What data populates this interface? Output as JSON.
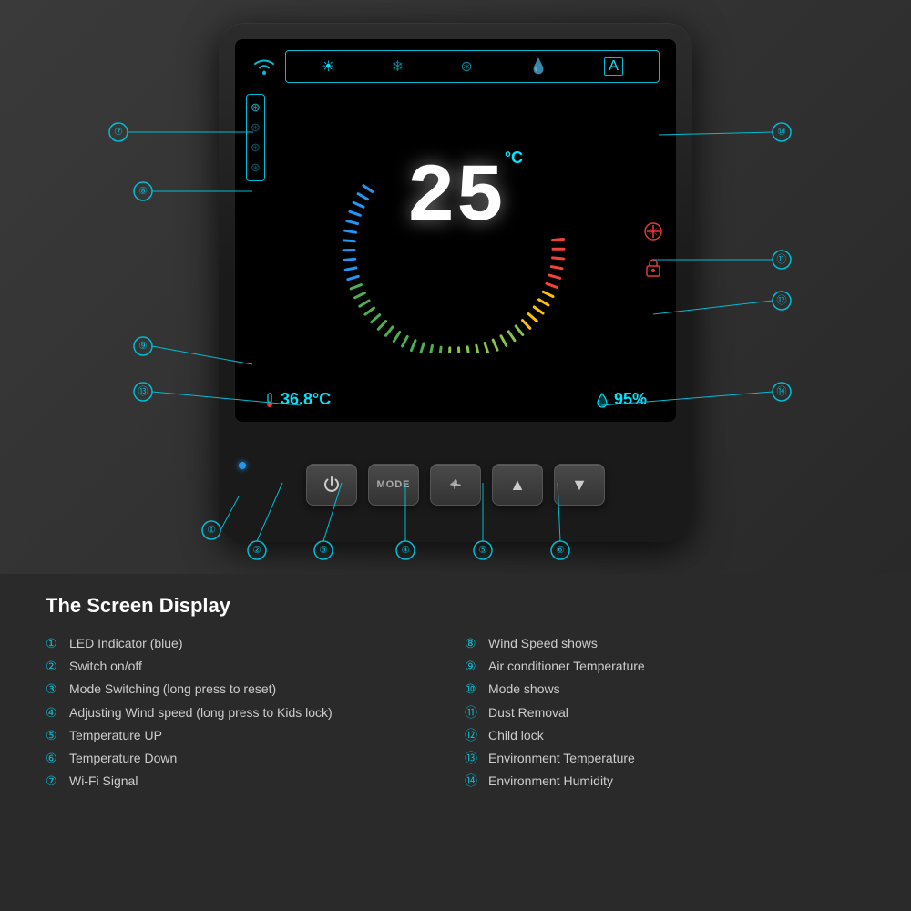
{
  "page": {
    "background_color": "#2a2a2a"
  },
  "device": {
    "screen": {
      "temperature_value": "25",
      "temperature_unit": "°C",
      "env_temp": "36.8°C",
      "env_humidity": "95%",
      "mode_icons": [
        "☀",
        "❄",
        "✦",
        "◈",
        "A"
      ],
      "fan_speeds": 4,
      "gauge_min": 16,
      "gauge_max": 30
    },
    "buttons": [
      {
        "label": "⏻",
        "id": "power"
      },
      {
        "label": "MODE",
        "id": "mode"
      },
      {
        "label": "✦",
        "id": "fan"
      },
      {
        "label": "▲",
        "id": "temp-up"
      },
      {
        "label": "▼",
        "id": "temp-down"
      }
    ]
  },
  "annotations": {
    "items": [
      {
        "num": "①",
        "label": "LED Indicator (blue)"
      },
      {
        "num": "②",
        "label": "Switch on/off"
      },
      {
        "num": "③",
        "label": "Mode Switching (long press to reset)"
      },
      {
        "num": "④",
        "label": "Adjusting Wind speed (long press to Kids lock)"
      },
      {
        "num": "⑤",
        "label": "Temperature UP"
      },
      {
        "num": "⑥",
        "label": "Temperature Down"
      },
      {
        "num": "⑦",
        "label": "Wi-Fi Signal"
      },
      {
        "num": "⑧",
        "label": "Wind Speed shows"
      },
      {
        "num": "⑨",
        "label": "Air conditioner Temperature"
      },
      {
        "num": "⑩",
        "label": "Mode shows"
      },
      {
        "num": "⑪",
        "label": "Dust Removal"
      },
      {
        "num": "⑫",
        "label": "Child lock"
      },
      {
        "num": "⑬",
        "label": "Environment Temperature"
      },
      {
        "num": "⑭",
        "label": "Environment Humidity"
      }
    ]
  },
  "description": {
    "title": "The Screen Display",
    "left_items": [
      {
        "num": "①",
        "text": "LED Indicator (blue)"
      },
      {
        "num": "②",
        "text": "Switch on/off"
      },
      {
        "num": "③",
        "text": "Mode Switching (long press to reset)"
      },
      {
        "num": "④",
        "text": "Adjusting Wind speed (long press to Kids lock)"
      },
      {
        "num": "⑤",
        "text": "Temperature UP"
      },
      {
        "num": "⑥",
        "text": "Temperature Down"
      },
      {
        "num": "⑦",
        "text": "Wi-Fi Signal"
      }
    ],
    "right_items": [
      {
        "num": "⑧",
        "text": "Wind Speed shows"
      },
      {
        "num": "⑨",
        "text": "Air conditioner Temperature"
      },
      {
        "num": "⑩",
        "text": "Mode shows"
      },
      {
        "num": "⑪",
        "text": "Dust Removal"
      },
      {
        "num": "⑫",
        "text": "Child lock"
      },
      {
        "num": "⑬",
        "text": "Environment Temperature"
      },
      {
        "num": "⑭",
        "text": "Environment Humidity"
      }
    ]
  }
}
